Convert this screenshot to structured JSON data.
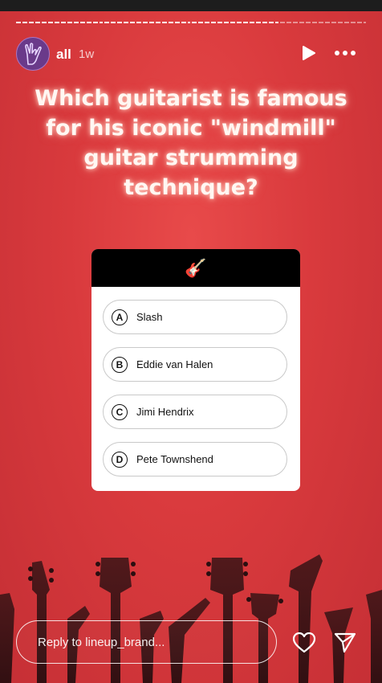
{
  "header": {
    "username": "all",
    "time": "1w"
  },
  "icons": {
    "avatar": "rock-hand-icon",
    "play": "play-icon",
    "more": "more-icon",
    "quiz_header": "guitar-emoji",
    "like": "heart-icon",
    "send": "send-icon"
  },
  "question": "Which guitarist is famous for his iconic \"windmill\" guitar strumming technique?",
  "quiz": {
    "emoji": "🎸",
    "options": [
      {
        "letter": "A",
        "text": "Slash"
      },
      {
        "letter": "B",
        "text": "Eddie van Halen"
      },
      {
        "letter": "C",
        "text": "Jimi Hendrix"
      },
      {
        "letter": "D",
        "text": "Pete Townshend"
      }
    ]
  },
  "reply": {
    "placeholder": "Reply to lineup_brand..."
  },
  "colors": {
    "background": "#d93a3d",
    "quiz_header": "#000000",
    "glow": "#ffd3c8"
  }
}
